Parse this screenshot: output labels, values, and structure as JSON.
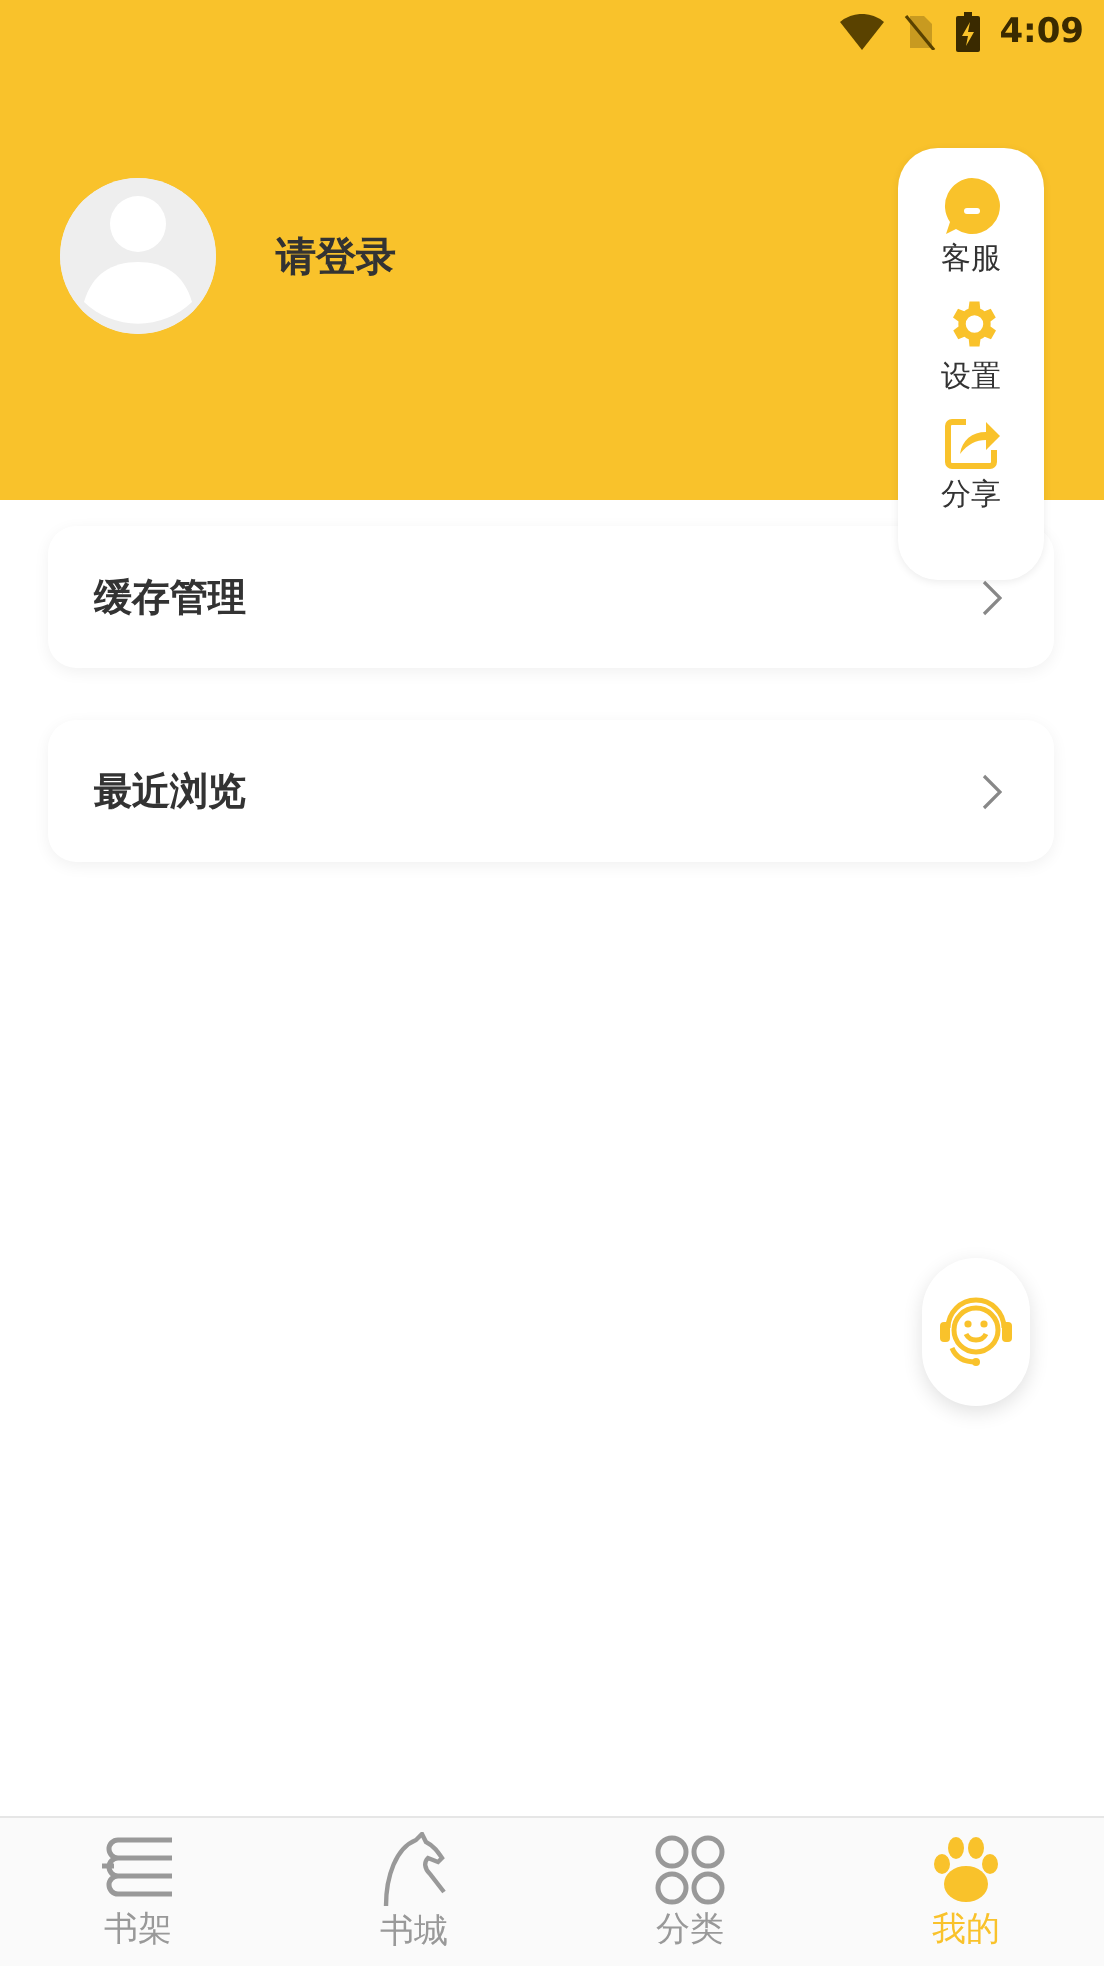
{
  "status_bar": {
    "time": "4:09"
  },
  "profile": {
    "name": "请登录"
  },
  "quick_menu": [
    {
      "kind": "chat",
      "label": "客服"
    },
    {
      "kind": "settings",
      "label": "设置"
    },
    {
      "kind": "share",
      "label": "分享"
    }
  ],
  "list_items": [
    {
      "label": "缓存管理"
    },
    {
      "label": "最近浏览"
    }
  ],
  "tabs": [
    {
      "kind": "shelf",
      "label": "书架",
      "selected": false
    },
    {
      "kind": "store",
      "label": "书城",
      "selected": false
    },
    {
      "kind": "category",
      "label": "分类",
      "selected": false
    },
    {
      "kind": "mine",
      "label": "我的",
      "selected": true
    }
  ]
}
